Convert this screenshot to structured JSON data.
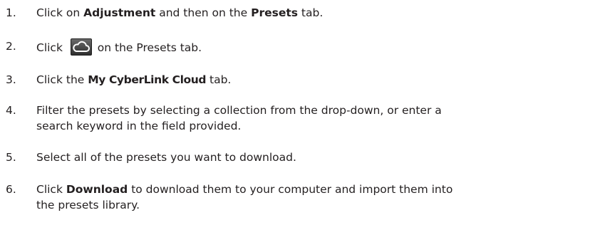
{
  "steps": [
    {
      "number": "1.",
      "parts": [
        "Click on ",
        "Adjustment",
        " and then on the ",
        "Presets",
        " tab."
      ]
    },
    {
      "number": "2.",
      "parts": [
        "Click ",
        " on the Presets tab."
      ],
      "icon": "cloud-icon"
    },
    {
      "number": "3.",
      "parts": [
        "Click the ",
        "My CyberLink Cloud",
        " tab."
      ]
    },
    {
      "number": "4.",
      "lines": [
        "Filter the presets by selecting a collection from the drop-down, or enter a",
        "search keyword in the field provided."
      ]
    },
    {
      "number": "5.",
      "parts": [
        "Select all of the presets you want to download."
      ]
    },
    {
      "number": "6.",
      "parts": [
        "Click ",
        "Download",
        " to download them to your computer and import them into"
      ],
      "line2": "the presets library."
    }
  ]
}
